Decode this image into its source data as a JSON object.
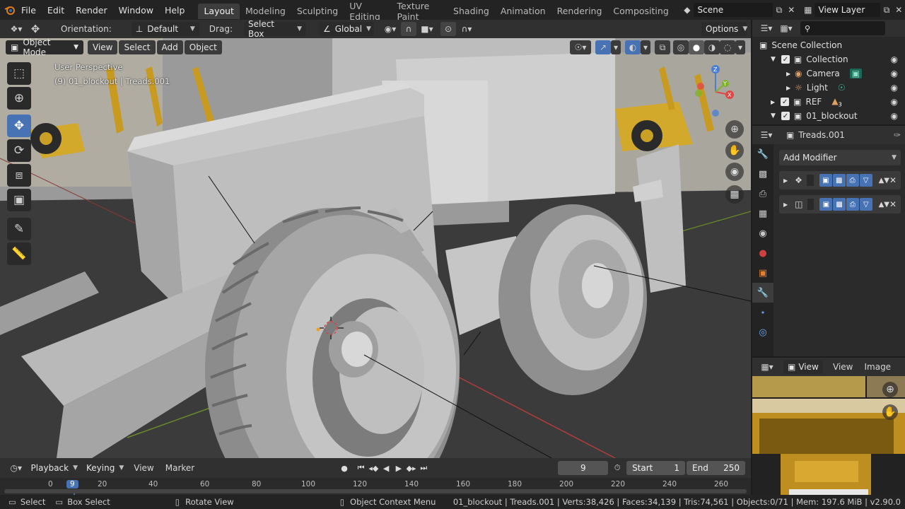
{
  "topbar": {
    "menus": [
      "File",
      "Edit",
      "Render",
      "Window",
      "Help"
    ],
    "workspaces": [
      "Layout",
      "Modeling",
      "Sculpting",
      "UV Editing",
      "Texture Paint",
      "Shading",
      "Animation",
      "Rendering",
      "Compositing"
    ],
    "active_workspace": "Layout",
    "scene_name": "Scene",
    "view_layer": "View Layer"
  },
  "toolheader": {
    "orientation_label": "Orientation:",
    "orientation_value": "Default",
    "drag_label": "Drag:",
    "drag_value": "Select Box",
    "transform_value": "Global",
    "options_label": "Options"
  },
  "viewport": {
    "mode": "Object Mode",
    "menus": [
      "View",
      "Select",
      "Add",
      "Object"
    ],
    "perspective_text": "User Perspective",
    "object_text": "(9) 01_blockout | Treads.001"
  },
  "outliner": {
    "search_placeholder": "",
    "rows": [
      {
        "label": "Scene Collection"
      },
      {
        "label": "Collection"
      },
      {
        "label": "Camera"
      },
      {
        "label": "Light"
      },
      {
        "label": "REF"
      },
      {
        "label": "01_blockout"
      }
    ],
    "ref_badge": "3"
  },
  "properties": {
    "object_name": "Treads.001",
    "add_modifier_label": "Add Modifier"
  },
  "image_editor": {
    "view_dropdown": "View",
    "menus": [
      "View",
      "Image"
    ]
  },
  "timeline": {
    "menus": [
      "Playback",
      "Keying",
      "View",
      "Marker"
    ],
    "current_frame": "9",
    "start_label": "Start",
    "start_value": "1",
    "end_label": "End",
    "end_value": "250",
    "ruler": [
      "0",
      "9",
      "20",
      "40",
      "60",
      "80",
      "100",
      "120",
      "140",
      "160",
      "180",
      "200",
      "220",
      "240",
      "260"
    ]
  },
  "statusbar": {
    "select": "Select",
    "box_select": "Box Select",
    "rotate_view": "Rotate View",
    "context_menu": "Object Context Menu",
    "stats": "01_blockout | Treads.001 | Verts:38,426 | Faces:34,139 | Tris:74,561 | Objects:0/71 | Mem: 197.6 MiB | v2.90.0"
  },
  "colors": {
    "accent": "#4772b3",
    "viewport_bg": "#3f3f3f",
    "panel_bg": "#2b2b2b"
  }
}
